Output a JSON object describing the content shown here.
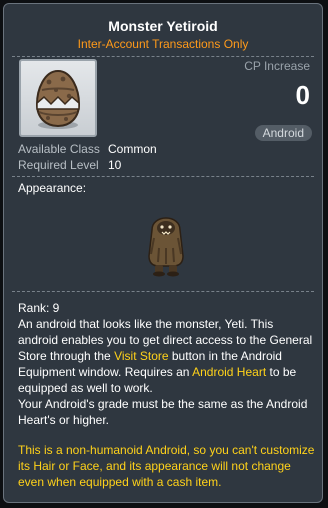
{
  "item": {
    "name": "Monster Yetiroid",
    "restriction": "Inter-Account Transactions Only",
    "icon": "egg-icon"
  },
  "cp": {
    "label": "CP Increase",
    "value": "0"
  },
  "type_badge": "Android",
  "stats": {
    "class_label": "Available Class",
    "class_value": "Common",
    "level_label": "Required Level",
    "level_value": "10"
  },
  "appearance": {
    "label": "Appearance:",
    "sprite": "yeti-sprite"
  },
  "description": {
    "rank": "Rank: 9",
    "part1": "An android that looks like the monster, Yeti. This android enables you to get direct access to the General Store through the ",
    "link1": "Visit Store",
    "part2": " button in the Android Equipment window. Requires an ",
    "link2": "Android Heart",
    "part3": " to be equipped as well to work.",
    "grade_note": "Your Android's grade must be the same as the Android Heart's or higher."
  },
  "warning": "This is a non-humanoid Android, so you can't customize its Hair or Face, and its appearance will not change even when equipped with a cash item.",
  "colors": {
    "background": "#2f3740",
    "title": "#ffffff",
    "restriction": "#ff9a1a",
    "highlight": "#ffd21a",
    "muted": "#9aa3ab"
  }
}
